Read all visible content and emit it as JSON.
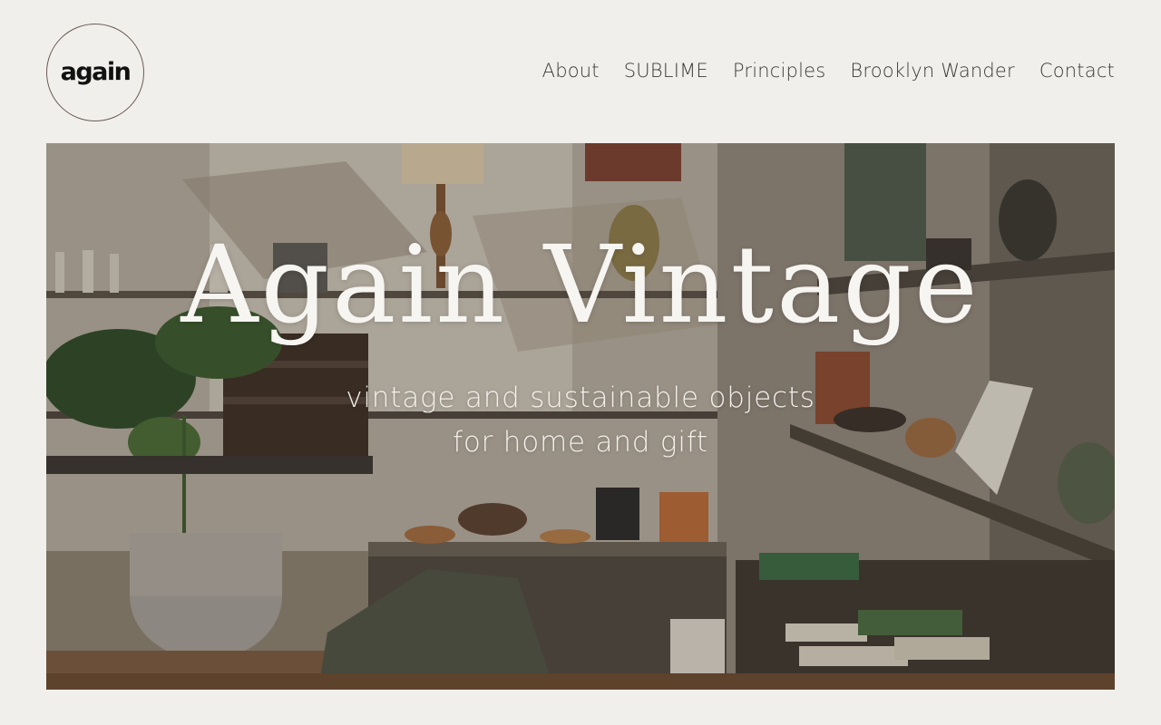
{
  "logo": {
    "text": "again"
  },
  "nav": {
    "items": [
      {
        "label": "About"
      },
      {
        "label": "SUBLIME"
      },
      {
        "label": "Principles"
      },
      {
        "label": "Brooklyn Wander"
      },
      {
        "label": "Contact"
      }
    ]
  },
  "hero": {
    "title": "Again Vintage",
    "subtitle_line1": "vintage and sustainable objects",
    "subtitle_line2": "for home and gift"
  },
  "colors": {
    "background": "#f0efeb",
    "nav_text": "#3d3a36",
    "hero_text": "#f7f5f1"
  }
}
